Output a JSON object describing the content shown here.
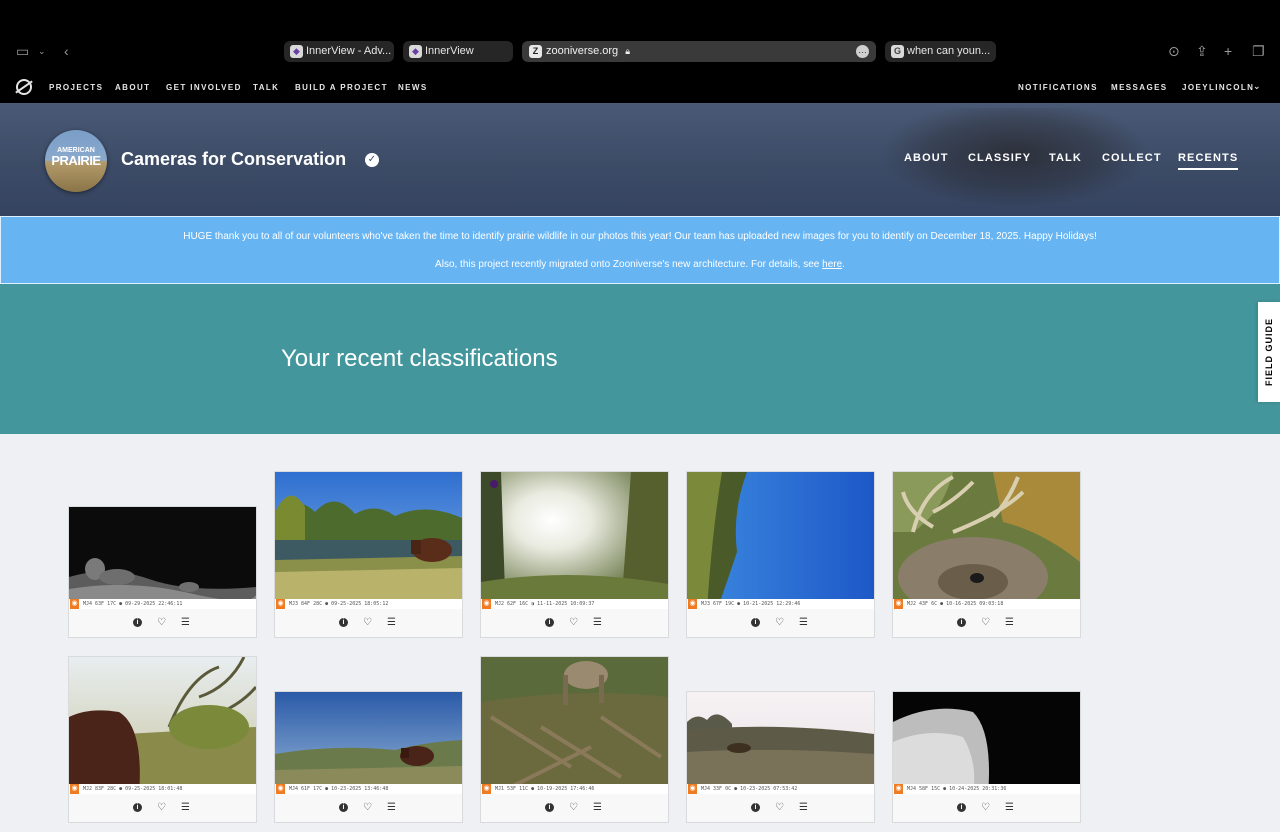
{
  "browser": {
    "tabs": [
      {
        "label": "InnerView - Adv...",
        "icon": "innerview-icon"
      },
      {
        "label": "InnerView",
        "icon": "innerview-icon"
      },
      {
        "label": "when can youn...",
        "icon": "google-icon"
      }
    ],
    "address": "zooniverse.org",
    "address_favicon": "Z",
    "google_favicon": "G"
  },
  "site_nav": {
    "left": [
      "PROJECTS",
      "ABOUT",
      "GET INVOLVED",
      "TALK",
      "BUILD A PROJECT",
      "NEWS"
    ],
    "right": [
      "NOTIFICATIONS",
      "MESSAGES",
      "JOEYLINCOLN"
    ]
  },
  "project": {
    "avatar_line1": "AMERICAN",
    "avatar_line2": "PRAIRIE",
    "title": "Cameras for Conservation",
    "nav": [
      "ABOUT",
      "CLASSIFY",
      "TALK",
      "COLLECT",
      "RECENTS"
    ],
    "active_nav": "RECENTS"
  },
  "announcement": {
    "line1": "HUGE thank you to all of our volunteers who've taken the time to identify prairie wildlife in our photos this year! Our team has uploaded new images for you to identify on December 18, 2025. Happy Holidays!",
    "line2_prefix": "Also, this project recently migrated onto Zooniverse's new architecture. For details, see ",
    "line2_link": "here",
    "line2_suffix": "."
  },
  "hero": {
    "title": "Your recent classifications"
  },
  "field_guide": "FIELD GUIDE",
  "recents": [
    {
      "strip": "MJ4            63F 17C   ●    09-29-2025  22:46:11",
      "scene": "night-grass"
    },
    {
      "strip": "MJ3            84F 28C   ●    09-25-2025  18:05:12",
      "scene": "river-cow"
    },
    {
      "strip": "MJ2            62F 16C   ◑    11-11-2025  10:09:37",
      "scene": "sunflare-trees"
    },
    {
      "strip": "MJ3            67F 19C   ●    10-21-2025  12:29:46",
      "scene": "sky-tilted"
    },
    {
      "strip": "MJ2            43F 6C    ●    10-16-2025  09:03:18",
      "scene": "deer-closeup"
    },
    {
      "strip": "MJ2            83F 28C   ●    09-25-2025  18:01:48",
      "scene": "cow-closeup"
    },
    {
      "strip": "MJ4            61F 17C   ●    10-23-2025  13:46:48",
      "scene": "cow-hill"
    },
    {
      "strip": "MJ1            53F 11C   ●    10-19-2025  17:46:46",
      "scene": "deer-ground"
    },
    {
      "strip": "MJ4            33F 0C    ●    10-23-2025  07:53:42",
      "scene": "field-dawn"
    },
    {
      "strip": "MJ4            58F 15C   ●    10-24-2025  20:31:36",
      "scene": "night-white"
    }
  ],
  "card_actions": {
    "info_icon": "i",
    "favorite_icon": "♡",
    "collect_icon": "☰"
  },
  "colors": {
    "hero": "#43969c",
    "announcement": "#67b4f3",
    "header": "#3c4b66",
    "badge": "#ef7b22"
  }
}
